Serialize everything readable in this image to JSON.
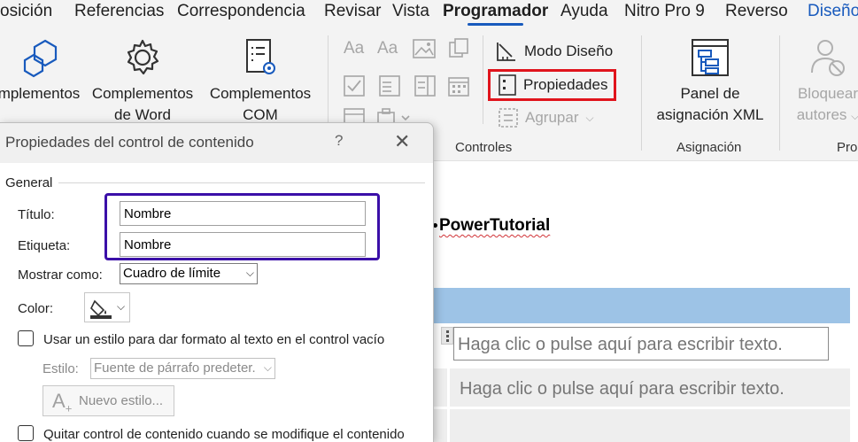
{
  "tabs": [
    {
      "label": "osición",
      "active": false
    },
    {
      "label": "Referencias",
      "active": false
    },
    {
      "label": "Correspondencia",
      "active": false
    },
    {
      "label": "Revisar",
      "active": false
    },
    {
      "label": "Vista",
      "active": false
    },
    {
      "label": "Programador",
      "active": true
    },
    {
      "label": "Ayuda",
      "active": false
    },
    {
      "label": "Nitro Pro 9",
      "active": false
    },
    {
      "label": "Reverso",
      "active": false
    },
    {
      "label": "Diseño",
      "active": false
    }
  ],
  "ribbon": {
    "complementos": {
      "line1": "mplementos"
    },
    "complementos_word": {
      "line1": "Complementos",
      "line2": "de Word"
    },
    "complementos_com": {
      "line1": "Complementos",
      "line2": "COM"
    },
    "modo_diseno": "Modo Diseño",
    "propiedades": "Propiedades",
    "agrupar": "Agrupar",
    "controles_label": "Controles",
    "panel": {
      "line1": "Panel de",
      "line2": "asignación XML"
    },
    "asignacion_label": "Asignación",
    "bloquear": {
      "line1": "Bloquear",
      "line2": "autores"
    },
    "pro_label": "Pro"
  },
  "dialog": {
    "title": "Propiedades del control de contenido",
    "help": "?",
    "close": "✕",
    "general_label": "General",
    "titulo_label": "Título:",
    "titulo_value": "Nombre",
    "etiqueta_label": "Etiqueta:",
    "etiqueta_value": "Nombre",
    "mostrar_label": "Mostrar como:",
    "mostrar_value": "Cuadro de límite",
    "color_label": "Color:",
    "usar_estilo_label": "Usar un estilo para dar formato al texto en el control vacío",
    "estilo_label": "Estilo:",
    "estilo_value": "Fuente de párrafo predeter.",
    "nuevo_estilo_label": "Nuevo estilo...",
    "quitar_label": "Quitar control de contenido cuando se modifique el contenido"
  },
  "document": {
    "title": "PowerTutorial",
    "placeholder1": "Haga clic o pulse aquí para escribir texto.",
    "placeholder2": "Haga clic o pulse aquí para escribir texto."
  }
}
